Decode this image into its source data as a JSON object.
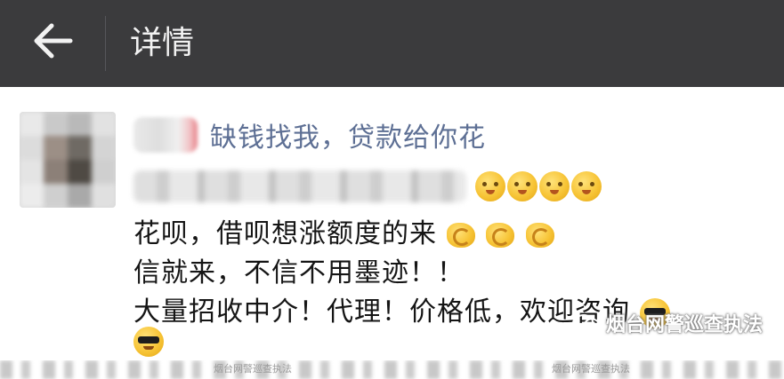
{
  "titlebar": {
    "back_icon": "back-arrow-icon",
    "title": "详情"
  },
  "post": {
    "nickname_suffix": "缺钱找我，贷款给你花",
    "line1": "花呗，借呗想涨额度的来",
    "line2": "信就来，不信不用墨迹！！",
    "line3": "大量招收中介！代理！价格低，欢迎咨询",
    "emojis": {
      "row_blur": [
        "grin-hands-icon",
        "grin-hands-icon",
        "grin-hands-icon",
        "grin-hands-icon"
      ],
      "line1": [
        "bicep-icon",
        "bicep-icon",
        "bicep-icon"
      ],
      "line3": [
        "sunglasses-face-icon"
      ],
      "tail": [
        "sunglasses-face-icon"
      ]
    }
  },
  "watermark": {
    "text": "烟台网警巡查执法"
  },
  "strip": {
    "wm_left": "烟台网警巡查执法",
    "wm_right": "烟台网警巡查执法"
  },
  "colors": {
    "titlebar_bg": "#3b3b3d",
    "nickname": "#5d6f94",
    "body_text": "#151515"
  }
}
